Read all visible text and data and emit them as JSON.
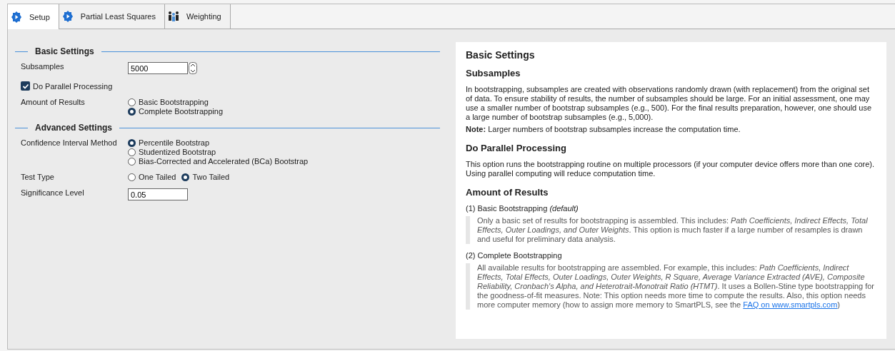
{
  "tabs": [
    {
      "label": "Setup",
      "selected": true,
      "kind": "gear"
    },
    {
      "label": "Partial Least Squares",
      "selected": false,
      "kind": "gear"
    },
    {
      "label": "Weighting",
      "selected": false,
      "kind": "people"
    }
  ],
  "settings": [
    {
      "title": "Basic Settings",
      "rows": [
        {
          "kind": "number",
          "label": "Subsamples",
          "value": "5000"
        },
        {
          "kind": "checkbox",
          "label": "Do Parallel Processing",
          "checked": true
        },
        {
          "kind": "radio",
          "label": "Amount of Results",
          "options": [
            {
              "label": "Basic Bootstrapping",
              "selected": false
            },
            {
              "label": "Complete Bootstrapping",
              "selected": true
            }
          ]
        }
      ]
    },
    {
      "title": "Advanced Settings",
      "rows": [
        {
          "kind": "radio",
          "label": "Confidence Interval Method",
          "options": [
            {
              "label": "Percentile Bootstrap",
              "selected": true
            },
            {
              "label": "Studentized Bootstrap",
              "selected": false
            },
            {
              "label": "Bias-Corrected and Accelerated (BCa) Bootstrap",
              "selected": false
            }
          ]
        },
        {
          "kind": "radio-inline",
          "label": "Test Type",
          "options": [
            {
              "label": "One Tailed",
              "selected": false
            },
            {
              "label": "Two Tailed",
              "selected": true
            }
          ]
        },
        {
          "kind": "text",
          "label": "Significance Level",
          "value": "0.05"
        }
      ]
    }
  ],
  "help": {
    "title": "Basic Settings",
    "sections": [
      {
        "heading": "Subsamples",
        "paragraphs": [
          "In bootstrapping, subsamples are created with observations randomly drawn (with replacement) from the original set of data. To ensure stability of results, the number of subsamples should be large. For an initial assessment, one may use a smaller number of bootstrap subsamples (e.g., 500). For the final results preparation, however, one should use a large number of bootstrap subsamples (e.g., 5,000).",
          "**Note:** Larger numbers of bootstrap subsamples increase the computation time."
        ]
      },
      {
        "heading": "Do Parallel Processing",
        "paragraphs": [
          "This option runs the bootstrapping routine on multiple processors (if your computer device offers more than one core). Using parallel computing will reduce computation time."
        ]
      },
      {
        "heading": "Amount of Results",
        "items": [
          {
            "title": "(1) Basic Bootstrapping *(default)*",
            "text": "Only a basic set of results for bootstrapping is assembled. This includes: *Path Coefficients, Indirect Effects, Total Effects, Outer Loadings, and Outer Weights*. This option is much faster if a large number of resamples is drawn and useful for preliminary data analysis."
          },
          {
            "title": "(2) Complete Bootstrapping",
            "text": "All available results for bootstrapping are assembled. For example, this includes: *Path Coefficients, Indirect Effects, Total Effects, Outer Loadings, Outer Weights, R Square, Average Variance Extracted (AVE), Composite Reliability, Cronbach's Alpha, and Heterotrait-Monotrait Ratio (HTMT)*. It uses a Bollen-Stine type bootstrapping for the goodness-of-fit measures. Note: This option needs more time to compute the results. Also, this option needs more computer memory (how to assign more memory to SmartPLS, see the ",
            "link": "FAQ on www.smartpls.com",
            "text_after": ")"
          }
        ]
      }
    ]
  }
}
